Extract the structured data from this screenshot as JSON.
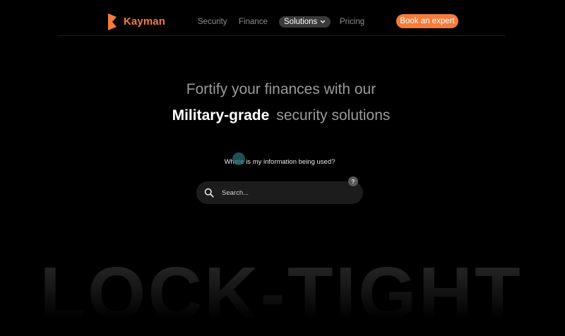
{
  "brand": {
    "name": "Kayman",
    "accent_color": "#f47c3c",
    "logo_icon": "kayman-logo-icon"
  },
  "nav": {
    "items": [
      {
        "label": "Security"
      },
      {
        "label": "Finance"
      },
      {
        "label": "Solutions",
        "icon": "chevron-down-icon",
        "active": true
      },
      {
        "label": "Pricing"
      }
    ],
    "cta_label": "Book an expert"
  },
  "hero": {
    "line1": "Fortify your finances with our",
    "line2_strong": "Military-grade",
    "line2_rest": "security solutions"
  },
  "search": {
    "question": "Where is my information being used?",
    "placeholder": "Search...",
    "value": "",
    "icon": "search-icon",
    "help_badge": "?"
  },
  "background_word": "LOCK-TIGHT"
}
